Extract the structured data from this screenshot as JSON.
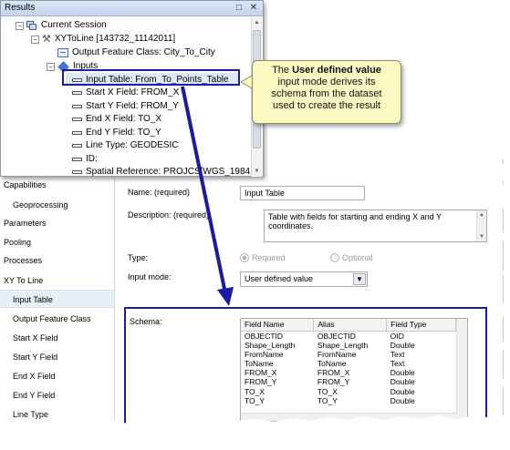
{
  "results_window": {
    "title": "Results",
    "tree": [
      {
        "label": "Current Session",
        "indent": 0
      },
      {
        "label": "XYToLine [143732_11142011]",
        "indent": 1
      },
      {
        "label": "Output Feature Class: City_To_City",
        "indent": 2
      },
      {
        "label": "Inputs",
        "indent": 2
      },
      {
        "label": "Input Table: From_To_Points_Table",
        "indent": 3
      },
      {
        "label": "Start X Field: FROM_X",
        "indent": 3
      },
      {
        "label": "Start Y Field: FROM_Y",
        "indent": 3
      },
      {
        "label": "End X Field: TO_X",
        "indent": 3
      },
      {
        "label": "End Y Field: TO_Y",
        "indent": 3
      },
      {
        "label": "Line Type: GEODESIC",
        "indent": 3
      },
      {
        "label": "ID:",
        "indent": 3
      },
      {
        "label": "Spatial Reference: PROJCS[WGS_1984",
        "indent": 3
      }
    ]
  },
  "callout": {
    "line1_prefix": "The ",
    "line1_bold": "User defined value",
    "line2": "input mode derives its",
    "line3": "schema from the dataset",
    "line4": "used to create the result"
  },
  "sidebar": {
    "items": [
      {
        "label": "G"
      },
      {
        "label": "Capabilities"
      },
      {
        "label": "Geoprocessing"
      },
      {
        "label": "Parameters"
      },
      {
        "label": "Pooling"
      },
      {
        "label": "Processes"
      },
      {
        "label": "XY To Line"
      },
      {
        "label": "Input Table"
      },
      {
        "label": "Output Feature Class"
      },
      {
        "label": "Start X Field"
      },
      {
        "label": "Start Y Field"
      },
      {
        "label": "End X Field"
      },
      {
        "label": "End Y Field"
      },
      {
        "label": "Line Type"
      }
    ]
  },
  "form": {
    "name_label": "Name:  (required)",
    "name_value": "Input Table",
    "description_label": "Description:  (required)",
    "description_value": "Table with fields for starting and ending X and Y coordinates.",
    "type_label": "Type:",
    "type_required": "Required",
    "type_optional": "Optional",
    "input_mode_label": "Input mode:",
    "input_mode_value": "User defined value",
    "schema_label": "Schema:"
  },
  "schema": {
    "columns": [
      "Field Name",
      "Alias",
      "Field Type"
    ],
    "rows": [
      [
        "OBJECTID",
        "OBJECTID",
        "OID"
      ],
      [
        "Shape_Length",
        "Shape_Length",
        "Double"
      ],
      [
        "FromName",
        "FromName",
        "Text"
      ],
      [
        "ToName",
        "ToName",
        "Text"
      ],
      [
        "FROM_X",
        "FROM_X",
        "Double"
      ],
      [
        "FROM_Y",
        "FROM_Y",
        "Double"
      ],
      [
        "TO_X",
        "TO_X",
        "Double"
      ],
      [
        "TO_Y",
        "TO_Y",
        "Double"
      ]
    ]
  },
  "icons": {
    "pin": "pin-icon",
    "close": "close-icon",
    "dropdown": "chevron-down-icon"
  },
  "colors": {
    "highlight_border": "#1a1aa6",
    "arrow": "#1a1aa6",
    "callout_bg": "#fbf8c2"
  }
}
